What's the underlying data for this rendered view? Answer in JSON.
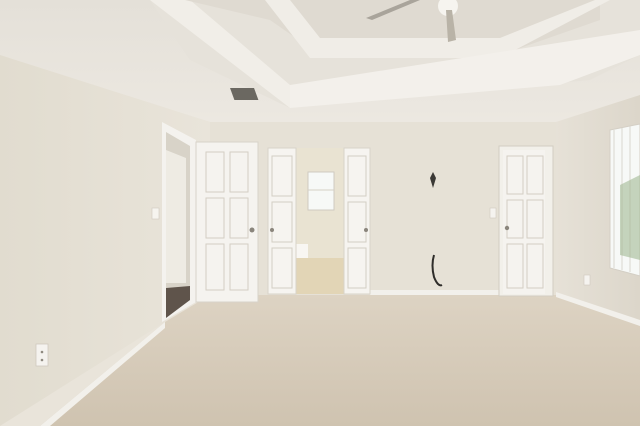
{
  "scene": {
    "description_free": true
  },
  "colors": {
    "wall": "#e7e2d8",
    "wall_shadow": "#d9d3c7",
    "ceiling": "#ebe7df",
    "ceiling_shadow": "#dcd7cd",
    "carpet": "#d6cbb9",
    "door": "#f4f2ee",
    "trim": "#f3f1ec",
    "bathroom_wall": "#e9e3d2",
    "bathroom_floor": "#e2d5b6",
    "hall_floor": "#5f544b",
    "window_glow": "#f7f9f7"
  }
}
